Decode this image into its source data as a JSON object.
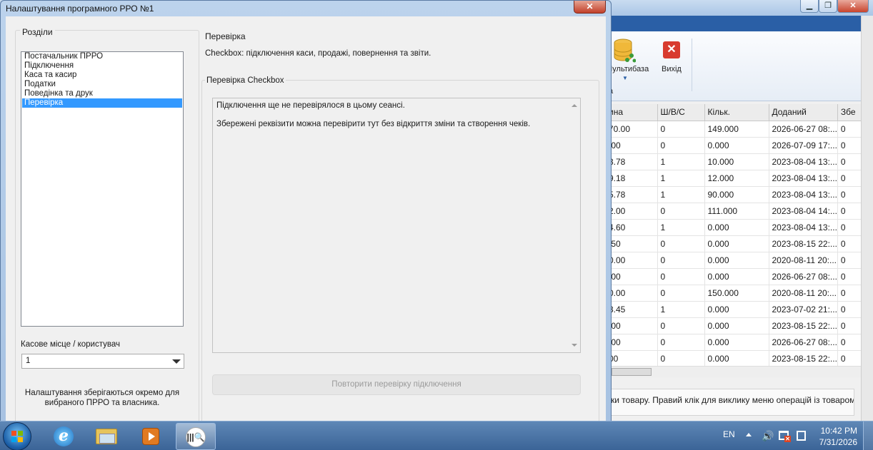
{
  "background_app": {
    "ribbon": {
      "multibase_label": "Мультибаза",
      "exit_label": "Вихід",
      "exit_icon": "close-x-icon",
      "group_caption": "а"
    },
    "grid": {
      "columns": [
        "ина",
        "Ш/В/С",
        "Кільк.",
        "Доданий",
        "Збе"
      ],
      "rows": [
        [
          "70.00",
          "0",
          "149.000",
          "2026-06-27 08:...",
          "0"
        ],
        [
          ".00",
          "0",
          "0.000",
          "2026-07-09 17:...",
          "0"
        ],
        [
          "3.78",
          "1",
          "10.000",
          "2023-08-04 13:...",
          "0"
        ],
        [
          "9.18",
          "1",
          "12.000",
          "2023-08-04 13:...",
          "0"
        ],
        [
          "5.78",
          "1",
          "90.000",
          "2023-08-04 13:...",
          "0"
        ],
        [
          "2.00",
          "0",
          "111.000",
          "2023-08-04 14:...",
          "0"
        ],
        [
          "4.60",
          "1",
          "0.000",
          "2023-08-04 13:...",
          "0"
        ],
        [
          ".50",
          "0",
          "0.000",
          "2023-08-15 22:...",
          "0"
        ],
        [
          "0.00",
          "0",
          "0.000",
          "2020-08-11 20:...",
          "0"
        ],
        [
          ".00",
          "0",
          "0.000",
          "2026-06-27 08:...",
          "0"
        ],
        [
          "0.00",
          "0",
          "150.000",
          "2020-08-11 20:...",
          "0"
        ],
        [
          "3.45",
          "1",
          "0.000",
          "2023-07-02 21:...",
          "0"
        ],
        [
          ".00",
          "0",
          "0.000",
          "2023-08-15 22:...",
          "0"
        ],
        [
          ".00",
          "0",
          "0.000",
          "2026-06-27 08:...",
          "0"
        ],
        [
          "00",
          "0",
          "0.000",
          "2023-08-15 22:...",
          "0"
        ],
        [
          ".00",
          "0",
          "0.000",
          "2026-06-27 08:...",
          "0"
        ]
      ]
    },
    "status_text": "ки товару. Правий клік для виклику меню операцій із товаром."
  },
  "dialog": {
    "title": "Налаштування програмного РРО №1",
    "close_glyph": "✕",
    "sections_label": "Розділи",
    "sections": [
      {
        "label": "Постачальник ПРРО"
      },
      {
        "label": "Підключення"
      },
      {
        "label": "Каса та касир"
      },
      {
        "label": "Податки"
      },
      {
        "label": "Поведінка та друк"
      },
      {
        "label": "Перевірка"
      }
    ],
    "selected_section": "Перевірка",
    "user_label": "Касове місце / користувач",
    "user_value": "1",
    "footnote": "Налаштування зберігаються окремо для вибраного ПРРО та власника.",
    "panel_title": "Перевірка",
    "panel_desc": "Checkbox: підключення каси, продажі, повернення та звіти.",
    "check_group_label": "Перевірка Checkbox",
    "result_line1": "Підключення ще не перевірялося в цьому сеансі.",
    "result_line2": "Збережені реквізити можна перевірити тут без відкриття зміни та створення чеків.",
    "retry_button": "Повторити перевірку підключення"
  },
  "taskbar": {
    "apps": [
      "internet-explorer-icon",
      "file-explorer-icon",
      "media-player-icon",
      "pos-app-icon"
    ],
    "pos_glyph": "|||🔍",
    "lang": "EN",
    "time": "10:42 PM",
    "date": "7/31/2026"
  },
  "colors": {
    "selection": "#3399ff",
    "ribbon_bar": "#2a5fa6",
    "exit_red": "#d83b2e",
    "taskbar": "#3b6497"
  }
}
